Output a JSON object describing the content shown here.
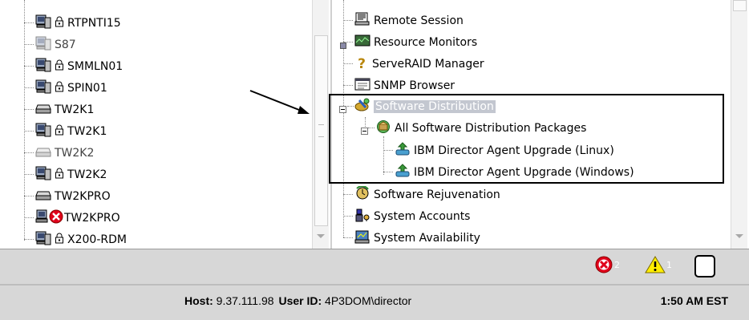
{
  "left_tree": {
    "items": [
      {
        "label": "RTPNTI15",
        "icon": "server-icon",
        "locked": true,
        "dim": false
      },
      {
        "label": "S87",
        "icon": "server-icon",
        "locked": false,
        "dim": true
      },
      {
        "label": "SMMLN01",
        "icon": "server-icon",
        "locked": true,
        "dim": false
      },
      {
        "label": "SPIN01",
        "icon": "server-icon",
        "locked": true,
        "dim": false
      },
      {
        "label": "TW2K1",
        "icon": "drive-icon",
        "locked": false,
        "dim": false
      },
      {
        "label": "TW2K1",
        "icon": "server-icon",
        "locked": true,
        "dim": false
      },
      {
        "label": "TW2K2",
        "icon": "drive-icon",
        "locked": false,
        "dim": true
      },
      {
        "label": "TW2K2",
        "icon": "server-icon",
        "locked": true,
        "dim": false
      },
      {
        "label": "TW2KPRO",
        "icon": "drive-icon",
        "locked": false,
        "dim": false
      },
      {
        "label": "TW2KPRO",
        "icon": "server-error-icon",
        "locked": false,
        "dim": false
      },
      {
        "label": "X200-RDM",
        "icon": "server-icon",
        "locked": true,
        "dim": false
      }
    ]
  },
  "right_tree": {
    "items": [
      {
        "label": "Remote Session",
        "icon": "remote-session-icon"
      },
      {
        "label": "Resource Monitors",
        "icon": "resource-monitor-icon"
      },
      {
        "label": "ServeRAID Manager",
        "icon": "question-icon"
      },
      {
        "label": "SNMP Browser",
        "icon": "snmp-browser-icon"
      },
      {
        "label": "Software Distribution",
        "icon": "software-distribution-icon"
      },
      {
        "label": "All Software Distribution Packages",
        "icon": "packages-icon"
      },
      {
        "label": "IBM Director Agent Upgrade (Linux)",
        "icon": "package-icon"
      },
      {
        "label": "IBM Director Agent Upgrade (Windows)",
        "icon": "package-icon"
      },
      {
        "label": "Software Rejuvenation",
        "icon": "rejuvenation-icon"
      },
      {
        "label": "System Accounts",
        "icon": "system-accounts-icon"
      },
      {
        "label": "System Availability",
        "icon": "system-availability-icon"
      }
    ]
  },
  "notifications": {
    "error_count": "2",
    "warning_count": "1"
  },
  "status": {
    "host_label": "Host:",
    "host_value": "9.37.111.98",
    "user_label": "User ID:",
    "user_value": "4P3DOM\\director",
    "time": "1:50 AM EST"
  },
  "colors": {
    "error": "#e0001b",
    "warning": "#ffee00",
    "selection": "#c3c7d0"
  }
}
